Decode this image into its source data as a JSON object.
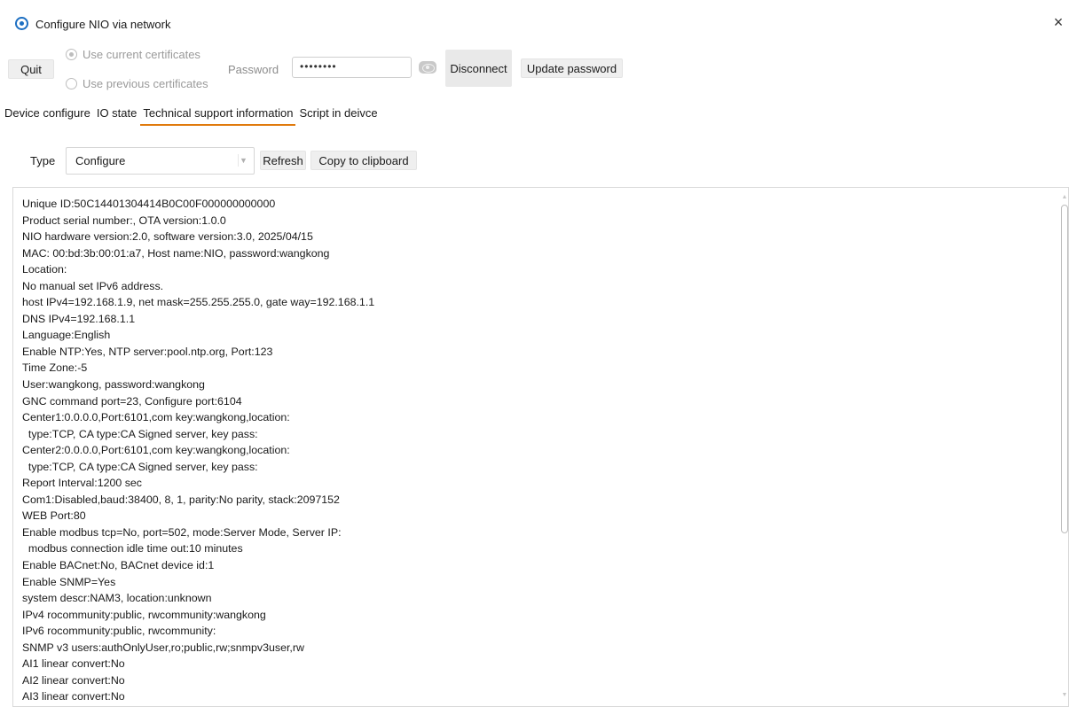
{
  "window": {
    "title": "Configure NIO via network",
    "app_icon": "gear-icon",
    "close_icon": "×"
  },
  "toolbar": {
    "quit_label": "Quit",
    "cert_options": [
      "Use current certificates",
      "Use previous certificates"
    ],
    "selected_cert_option": "Use current certificates",
    "password_label": "Password",
    "password_value": "••••••••",
    "show_password_icon": "eye-icon",
    "disconnect_label": "Disconnect",
    "update_password_label": "Update password"
  },
  "tabs": [
    {
      "label": "Device configure",
      "active": false
    },
    {
      "label": "IO state",
      "active": false
    },
    {
      "label": "Technical support information",
      "active": true
    },
    {
      "label": "Script in deivce",
      "active": false
    }
  ],
  "controls": {
    "type_label": "Type",
    "type_value": "Configure",
    "refresh_label": "Refresh",
    "copy_label": "Copy to clipboard"
  },
  "info_lines": [
    "Unique ID:50C14401304414B0C00F000000000000",
    "Product serial number:, OTA version:1.0.0",
    "NIO hardware version:2.0, software version:3.0, 2025/04/15",
    "MAC: 00:bd:3b:00:01:a7, Host name:NIO, password:wangkong",
    "Location:",
    "No manual set IPv6 address.",
    "host IPv4=192.168.1.9, net mask=255.255.255.0, gate way=192.168.1.1",
    "DNS IPv4=192.168.1.1",
    "Language:English",
    "Enable NTP:Yes, NTP server:pool.ntp.org, Port:123",
    "Time Zone:-5",
    "User:wangkong, password:wangkong",
    "GNC command port=23, Configure port:6104",
    "Center1:0.0.0.0,Port:6101,com key:wangkong,location:",
    "  type:TCP, CA type:CA Signed server, key pass:",
    "Center2:0.0.0.0,Port:6101,com key:wangkong,location:",
    "  type:TCP, CA type:CA Signed server, key pass:",
    "Report Interval:1200 sec",
    "Com1:Disabled,baud:38400, 8, 1, parity:No parity, stack:2097152",
    "WEB Port:80",
    "Enable modbus tcp=No, port=502, mode:Server Mode, Server IP:",
    "  modbus connection idle time out:10 minutes",
    "Enable BACnet:No, BACnet device id:1",
    "Enable SNMP=Yes",
    "system descr:NAM3, location:unknown",
    "IPv4 rocommunity:public, rwcommunity:wangkong",
    "IPv6 rocommunity:public, rwcommunity:",
    "SNMP v3 users:authOnlyUser,ro;public,rw;snmpv3user,rw",
    "AI1 linear convert:No",
    "AI2 linear convert:No",
    "AI3 linear convert:No"
  ],
  "colors": {
    "active_tab_underline": "#e07a0c",
    "icon_accent": "#1d6fc2",
    "disabled_text": "#9a9a9a"
  }
}
